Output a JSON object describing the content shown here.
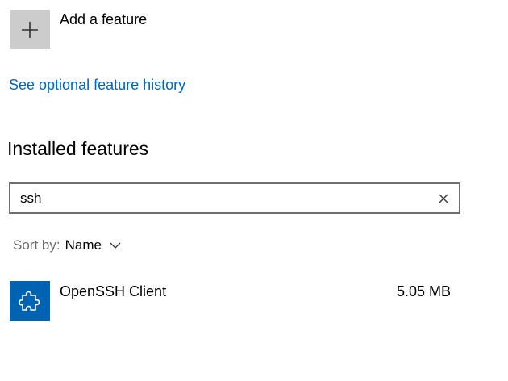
{
  "add_feature": {
    "label": "Add a feature",
    "icon": "plus-icon",
    "tile_color": "#cccccc"
  },
  "history_link": {
    "label": "See optional feature history",
    "color": "#0067b8"
  },
  "installed": {
    "heading": "Installed features",
    "search": {
      "value": "ssh",
      "clear_icon": "close-icon"
    },
    "sort": {
      "prefix": "Sort by:",
      "value": "Name",
      "icon": "chevron-down-icon"
    },
    "items": [
      {
        "name": "OpenSSH Client",
        "size": "5.05 MB",
        "icon": "puzzle-piece-icon",
        "tile_color": "#0063b1"
      }
    ]
  }
}
